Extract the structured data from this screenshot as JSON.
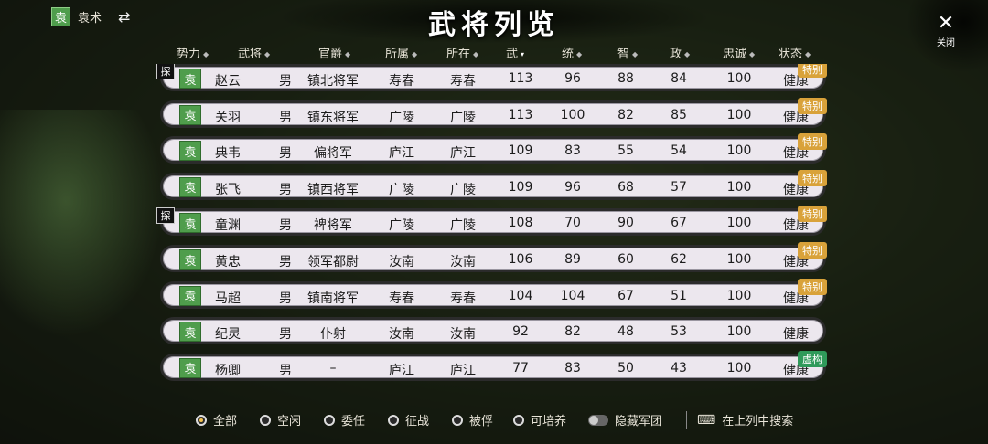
{
  "faction": {
    "badge": "袁",
    "name": "袁术",
    "swap_icon": "swap-arrows-icon"
  },
  "title": "武将列览",
  "close": {
    "icon": "close-icon",
    "label": "关闭"
  },
  "columns": [
    {
      "label": "势力",
      "sorted": false
    },
    {
      "label": "武将",
      "sorted": false
    },
    {
      "label": "官爵",
      "sorted": false
    },
    {
      "label": "所属",
      "sorted": false
    },
    {
      "label": "所在",
      "sorted": false
    },
    {
      "label": "武",
      "sorted": true
    },
    {
      "label": "统",
      "sorted": false
    },
    {
      "label": "智",
      "sorted": false
    },
    {
      "label": "政",
      "sorted": false
    },
    {
      "label": "忠诚",
      "sorted": false
    },
    {
      "label": "状态",
      "sorted": false
    }
  ],
  "generals": [
    {
      "faction": "袁",
      "name": "赵云",
      "gender": "男",
      "rank": "镇北将军",
      "belong": "寿春",
      "location": "寿春",
      "war": "113",
      "lead": "96",
      "intel": "88",
      "pol": "84",
      "loyalty": "100",
      "status": "健康",
      "tag": "特别",
      "tag_type": "special",
      "scout": "探"
    },
    {
      "faction": "袁",
      "name": "关羽",
      "gender": "男",
      "rank": "镇东将军",
      "belong": "广陵",
      "location": "广陵",
      "war": "113",
      "lead": "100",
      "intel": "82",
      "pol": "85",
      "loyalty": "100",
      "status": "健康",
      "tag": "特别",
      "tag_type": "special",
      "scout": ""
    },
    {
      "faction": "袁",
      "name": "典韦",
      "gender": "男",
      "rank": "偏将军",
      "belong": "庐江",
      "location": "庐江",
      "war": "109",
      "lead": "83",
      "intel": "55",
      "pol": "54",
      "loyalty": "100",
      "status": "健康",
      "tag": "特别",
      "tag_type": "special",
      "scout": ""
    },
    {
      "faction": "袁",
      "name": "张飞",
      "gender": "男",
      "rank": "镇西将军",
      "belong": "广陵",
      "location": "广陵",
      "war": "109",
      "lead": "96",
      "intel": "68",
      "pol": "57",
      "loyalty": "100",
      "status": "健康",
      "tag": "特别",
      "tag_type": "special",
      "scout": ""
    },
    {
      "faction": "袁",
      "name": "童渊",
      "gender": "男",
      "rank": "裨将军",
      "belong": "广陵",
      "location": "广陵",
      "war": "108",
      "lead": "70",
      "intel": "90",
      "pol": "67",
      "loyalty": "100",
      "status": "健康",
      "tag": "特别",
      "tag_type": "special",
      "scout": "探"
    },
    {
      "faction": "袁",
      "name": "黄忠",
      "gender": "男",
      "rank": "领军都尉",
      "belong": "汝南",
      "location": "汝南",
      "war": "106",
      "lead": "89",
      "intel": "60",
      "pol": "62",
      "loyalty": "100",
      "status": "健康",
      "tag": "特别",
      "tag_type": "special",
      "scout": ""
    },
    {
      "faction": "袁",
      "name": "马超",
      "gender": "男",
      "rank": "镇南将军",
      "belong": "寿春",
      "location": "寿春",
      "war": "104",
      "lead": "104",
      "intel": "67",
      "pol": "51",
      "loyalty": "100",
      "status": "健康",
      "tag": "特别",
      "tag_type": "special",
      "scout": ""
    },
    {
      "faction": "袁",
      "name": "纪灵",
      "gender": "男",
      "rank": "仆射",
      "belong": "汝南",
      "location": "汝南",
      "war": "92",
      "lead": "82",
      "intel": "48",
      "pol": "53",
      "loyalty": "100",
      "status": "健康",
      "tag": "",
      "tag_type": "",
      "scout": ""
    },
    {
      "faction": "袁",
      "name": "杨卿",
      "gender": "男",
      "rank": "–",
      "belong": "庐江",
      "location": "庐江",
      "war": "77",
      "lead": "83",
      "intel": "50",
      "pol": "43",
      "loyalty": "100",
      "status": "健康",
      "tag": "虚构",
      "tag_type": "virtual",
      "scout": ""
    }
  ],
  "filters": [
    {
      "label": "全部",
      "checked": true
    },
    {
      "label": "空闲",
      "checked": false
    },
    {
      "label": "委任",
      "checked": false
    },
    {
      "label": "征战",
      "checked": false
    },
    {
      "label": "被俘",
      "checked": false
    },
    {
      "label": "可培养",
      "checked": false
    }
  ],
  "hide_army": {
    "label": "隐藏军团",
    "on": false
  },
  "search": {
    "icon": "keyboard-icon",
    "label": "在上列中搜索"
  }
}
